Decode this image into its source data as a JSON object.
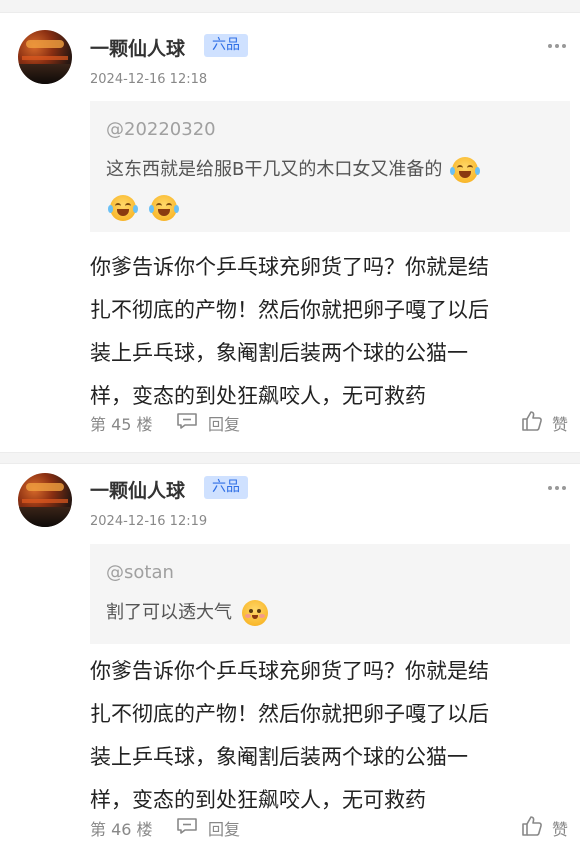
{
  "posts": [
    {
      "username": "一颗仙人球",
      "level": "六品",
      "timestamp": "2024-12-16 12:18",
      "quote": {
        "mention": "@20220320",
        "text": "这东西就是给服B干几又的木口女又准备的",
        "emojis": [
          "laugh-cry-emoji",
          "laugh-cry-emoji",
          "laugh-cry-emoji"
        ]
      },
      "content_lines": [
        "你爹告诉你个乒乓球充卵货了吗？你就是结",
        "扎不彻底的产物！然后你就把卵子嘎了以后",
        "装上乒乓球，象阉割后装两个球的公猫一",
        "样，变态的到处狂飙咬人，无可救药"
      ],
      "floor": "第 45 楼",
      "reply_label": "回复",
      "like_label": "赞"
    },
    {
      "username": "一颗仙人球",
      "level": "六品",
      "timestamp": "2024-12-16 12:19",
      "quote": {
        "mention": "@sotan",
        "text": "割了可以透大气",
        "emojis": [
          "blush-emoji"
        ]
      },
      "content_lines": [
        "你爹告诉你个乒乓球充卵货了吗？你就是结",
        "扎不彻底的产物！然后你就把卵子嘎了以后",
        "装上乒乓球，象阉割后装两个球的公猫一",
        "样，变态的到处狂飙咬人，无可救药"
      ],
      "floor": "第 46 楼",
      "reply_label": "回复",
      "like_label": "赞"
    }
  ],
  "colors": {
    "level_badge_bg": "#cfe1ff",
    "level_badge_text": "#2f6fe6",
    "quote_bg": "#f5f5f5",
    "muted_text": "#888888"
  }
}
